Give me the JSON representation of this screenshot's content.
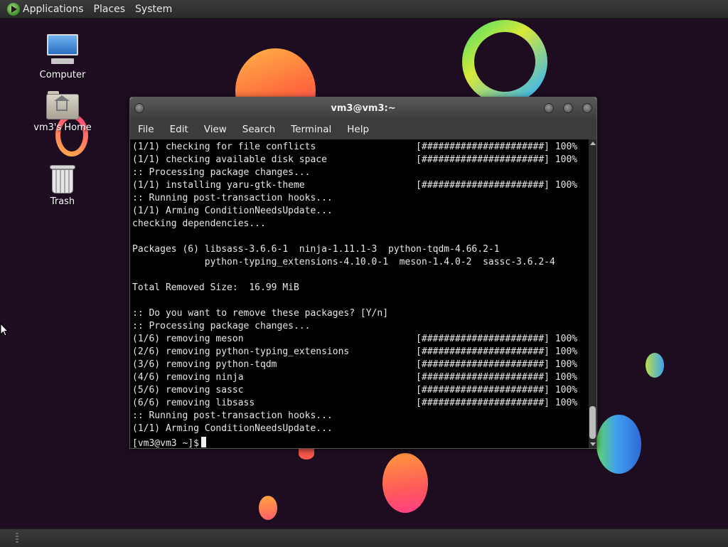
{
  "top_panel": {
    "menus": [
      "Applications",
      "Places",
      "System"
    ]
  },
  "desktop": {
    "icons": [
      {
        "label": "Computer",
        "icon": "computer-icon"
      },
      {
        "label": "vm3's Home",
        "icon": "home-folder-icon"
      },
      {
        "label": "Trash",
        "icon": "trash-icon"
      }
    ]
  },
  "terminal": {
    "title": "vm3@vm3:~",
    "menu": [
      "File",
      "Edit",
      "View",
      "Search",
      "Terminal",
      "Help"
    ],
    "lines": [
      "(1/1) checking for file conflicts                  [######################] 100%",
      "(1/1) checking available disk space                [######################] 100%",
      ":: Processing package changes...",
      "(1/1) installing yaru-gtk-theme                    [######################] 100%",
      ":: Running post-transaction hooks...",
      "(1/1) Arming ConditionNeedsUpdate...",
      "checking dependencies...",
      "",
      "Packages (6) libsass-3.6.6-1  ninja-1.11.1-3  python-tqdm-4.66.2-1",
      "             python-typing_extensions-4.10.0-1  meson-1.4.0-2  sassc-3.6.2-4",
      "",
      "Total Removed Size:  16.99 MiB",
      "",
      ":: Do you want to remove these packages? [Y/n]",
      ":: Processing package changes...",
      "(1/6) removing meson                               [######################] 100%",
      "(2/6) removing python-typing_extensions            [######################] 100%",
      "(3/6) removing python-tqdm                         [######################] 100%",
      "(4/6) removing ninja                               [######################] 100%",
      "(5/6) removing sassc                               [######################] 100%",
      "(6/6) removing libsass                             [######################] 100%",
      ":: Running post-transaction hooks...",
      "(1/1) Arming ConditionNeedsUpdate..."
    ],
    "prompt": "[vm3@vm3 ~]$"
  },
  "colors": {
    "desktop_bg": "#1e0d21",
    "terminal_bg": "#000000",
    "terminal_fg": "#e6e6e6",
    "panel_bg": "#2b2b2b"
  }
}
